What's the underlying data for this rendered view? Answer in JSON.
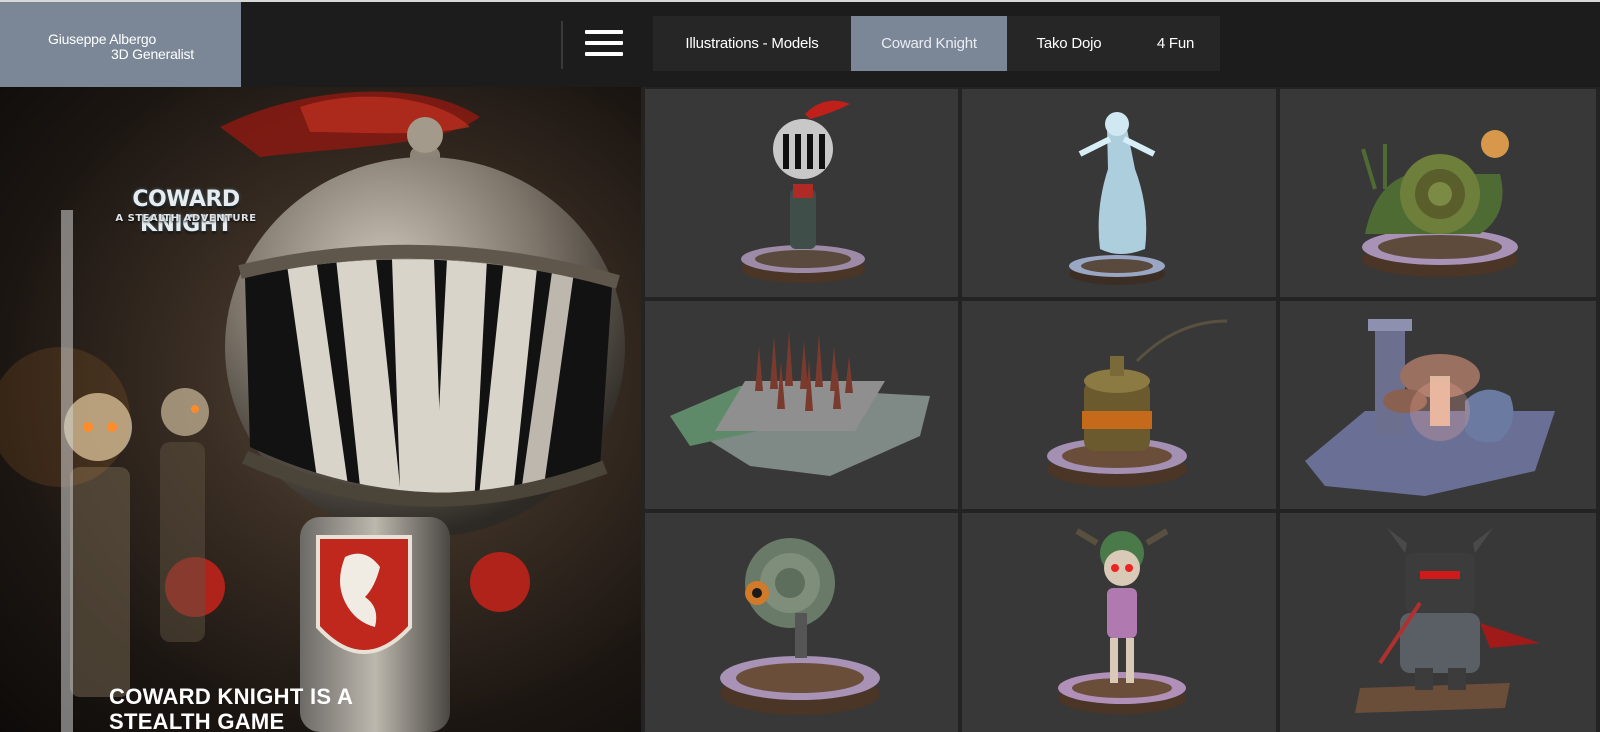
{
  "brand": {
    "name": "Giuseppe Albergo",
    "role": "3D Generalist"
  },
  "nav": {
    "menu_icon": "hamburger-menu-icon",
    "tabs": [
      {
        "label": "Illustrations - Models",
        "active": false
      },
      {
        "label": "Coward Knight",
        "active": true
      },
      {
        "label": "Tako Dojo",
        "active": false
      },
      {
        "label": "4 Fun",
        "active": false
      }
    ]
  },
  "hero": {
    "logo_title": "COWARD KNIGHT",
    "logo_subtitle": "A STEALTH ADVENTURE",
    "headline_line1": "COWARD KNIGHT IS A",
    "headline_line2": "STEALTH GAME"
  },
  "gallery": {
    "items": [
      {
        "subject": "knight-with-striped-helmet-on-pedestal"
      },
      {
        "subject": "ghost-woman-on-pedestal"
      },
      {
        "subject": "snail-with-lantern-on-pedestal"
      },
      {
        "subject": "spike-trap-on-stone-floor"
      },
      {
        "subject": "oil-can-on-pedestal"
      },
      {
        "subject": "column-and-mushrooms-on-stone-floor"
      },
      {
        "subject": "wall-cannon-on-pedestal"
      },
      {
        "subject": "skeleton-viking-on-pedestal"
      },
      {
        "subject": "horned-dark-knight-on-pedestal"
      }
    ]
  },
  "colors": {
    "accent": "#7b8797",
    "topbar": "#1c1c1c",
    "tile": "#383838"
  }
}
